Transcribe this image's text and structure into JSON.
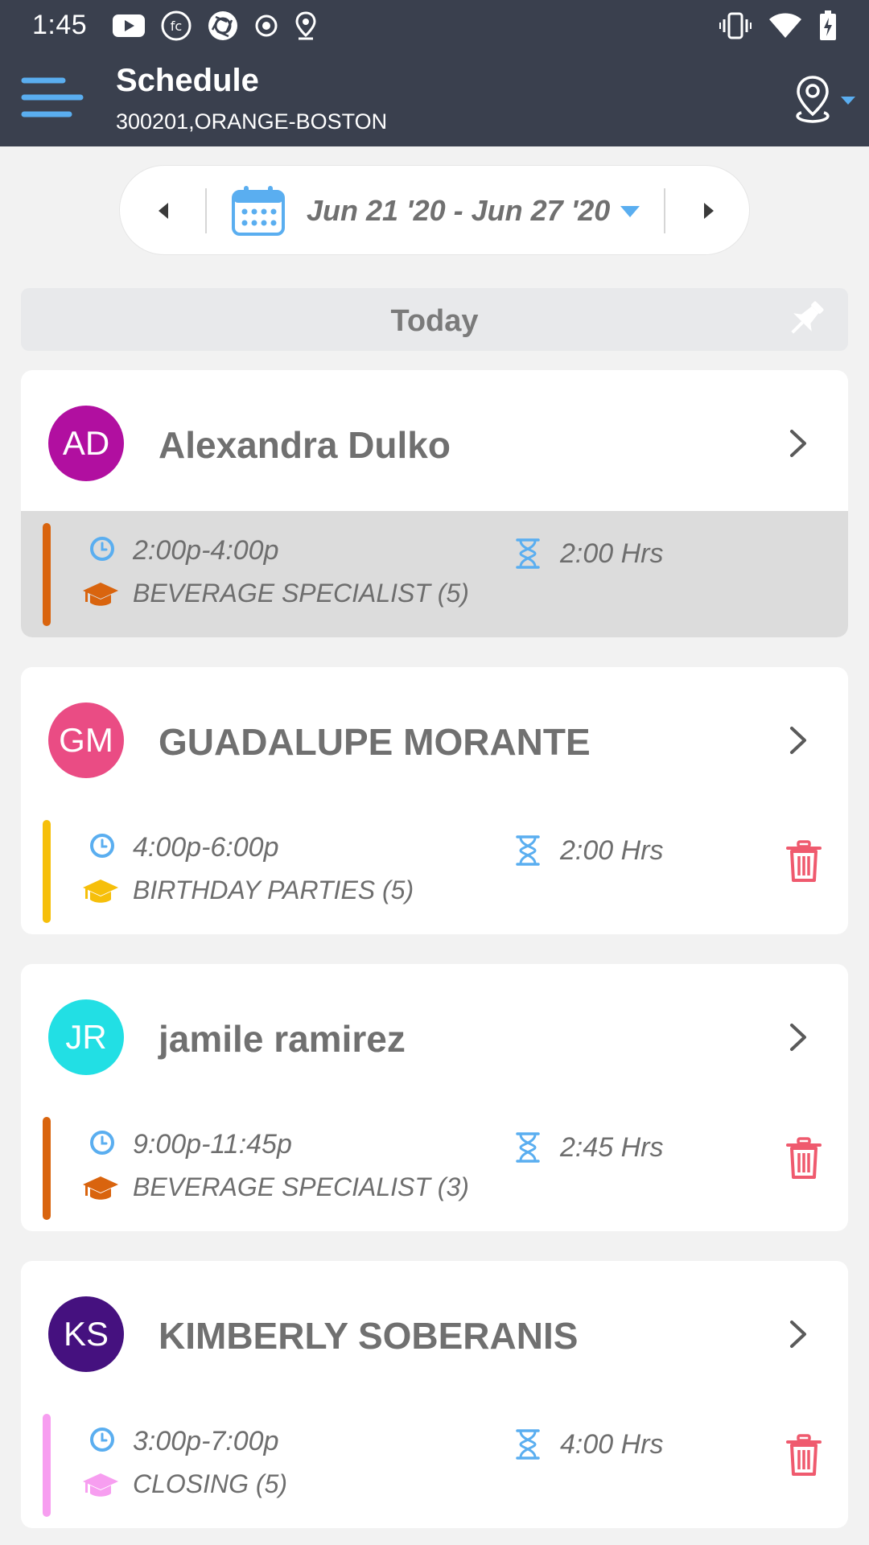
{
  "status_bar": {
    "time": "1:45",
    "left_icons": [
      "youtube-icon",
      "fc-icon",
      "camera-aperture-icon",
      "record-icon",
      "location-pin-icon"
    ],
    "right_icons": [
      "vibrate-icon",
      "wifi-icon",
      "battery-charging-icon"
    ]
  },
  "app_bar": {
    "title": "Schedule",
    "subtitle": "300201,ORANGE-BOSTON",
    "menu_icon": "hamburger-menu-icon",
    "location_icon": "location-pin-icon"
  },
  "week_nav": {
    "label": "Jun 21 '20 - Jun 27 '20",
    "prev_icon": "triangle-left-icon",
    "next_icon": "triangle-right-icon",
    "calendar_icon": "calendar-icon",
    "dropdown_icon": "caret-down-icon"
  },
  "section": {
    "label": "Today",
    "pin_icon": "pushpin-icon"
  },
  "colors": {
    "app_bar": "#3a404e",
    "accent_blue": "#5aaef0",
    "delete_red": "#ef5a6e",
    "text_gray": "#707070"
  },
  "employees": [
    {
      "initials": "AD",
      "name": "Alexandra Dulko",
      "avatar_color": "#b10fa0",
      "shift": {
        "time": "2:00p-4:00p",
        "hours": "2:00 Hrs",
        "role": "BEVERAGE SPECIALIST (5)",
        "role_color": "#d9640e",
        "highlighted": true,
        "deletable": false
      }
    },
    {
      "initials": "GM",
      "name": "GUADALUPE MORANTE",
      "avatar_color": "#ea4c84",
      "shift": {
        "time": "4:00p-6:00p",
        "hours": "2:00 Hrs",
        "role": "BIRTHDAY PARTIES (5)",
        "role_color": "#f6bf0a",
        "highlighted": false,
        "deletable": true
      }
    },
    {
      "initials": "JR",
      "name": "jamile ramirez",
      "avatar_color": "#22dfe4",
      "shift": {
        "time": "9:00p-11:45p",
        "hours": "2:45 Hrs",
        "role": "BEVERAGE SPECIALIST (3)",
        "role_color": "#d9640e",
        "highlighted": false,
        "deletable": true
      }
    },
    {
      "initials": "KS",
      "name": "KIMBERLY SOBERANIS",
      "avatar_color": "#45117f",
      "shift": {
        "time": "3:00p-7:00p",
        "hours": "4:00 Hrs",
        "role": "CLOSING (5)",
        "role_color": "#f79ef0",
        "highlighted": false,
        "deletable": true
      }
    }
  ]
}
